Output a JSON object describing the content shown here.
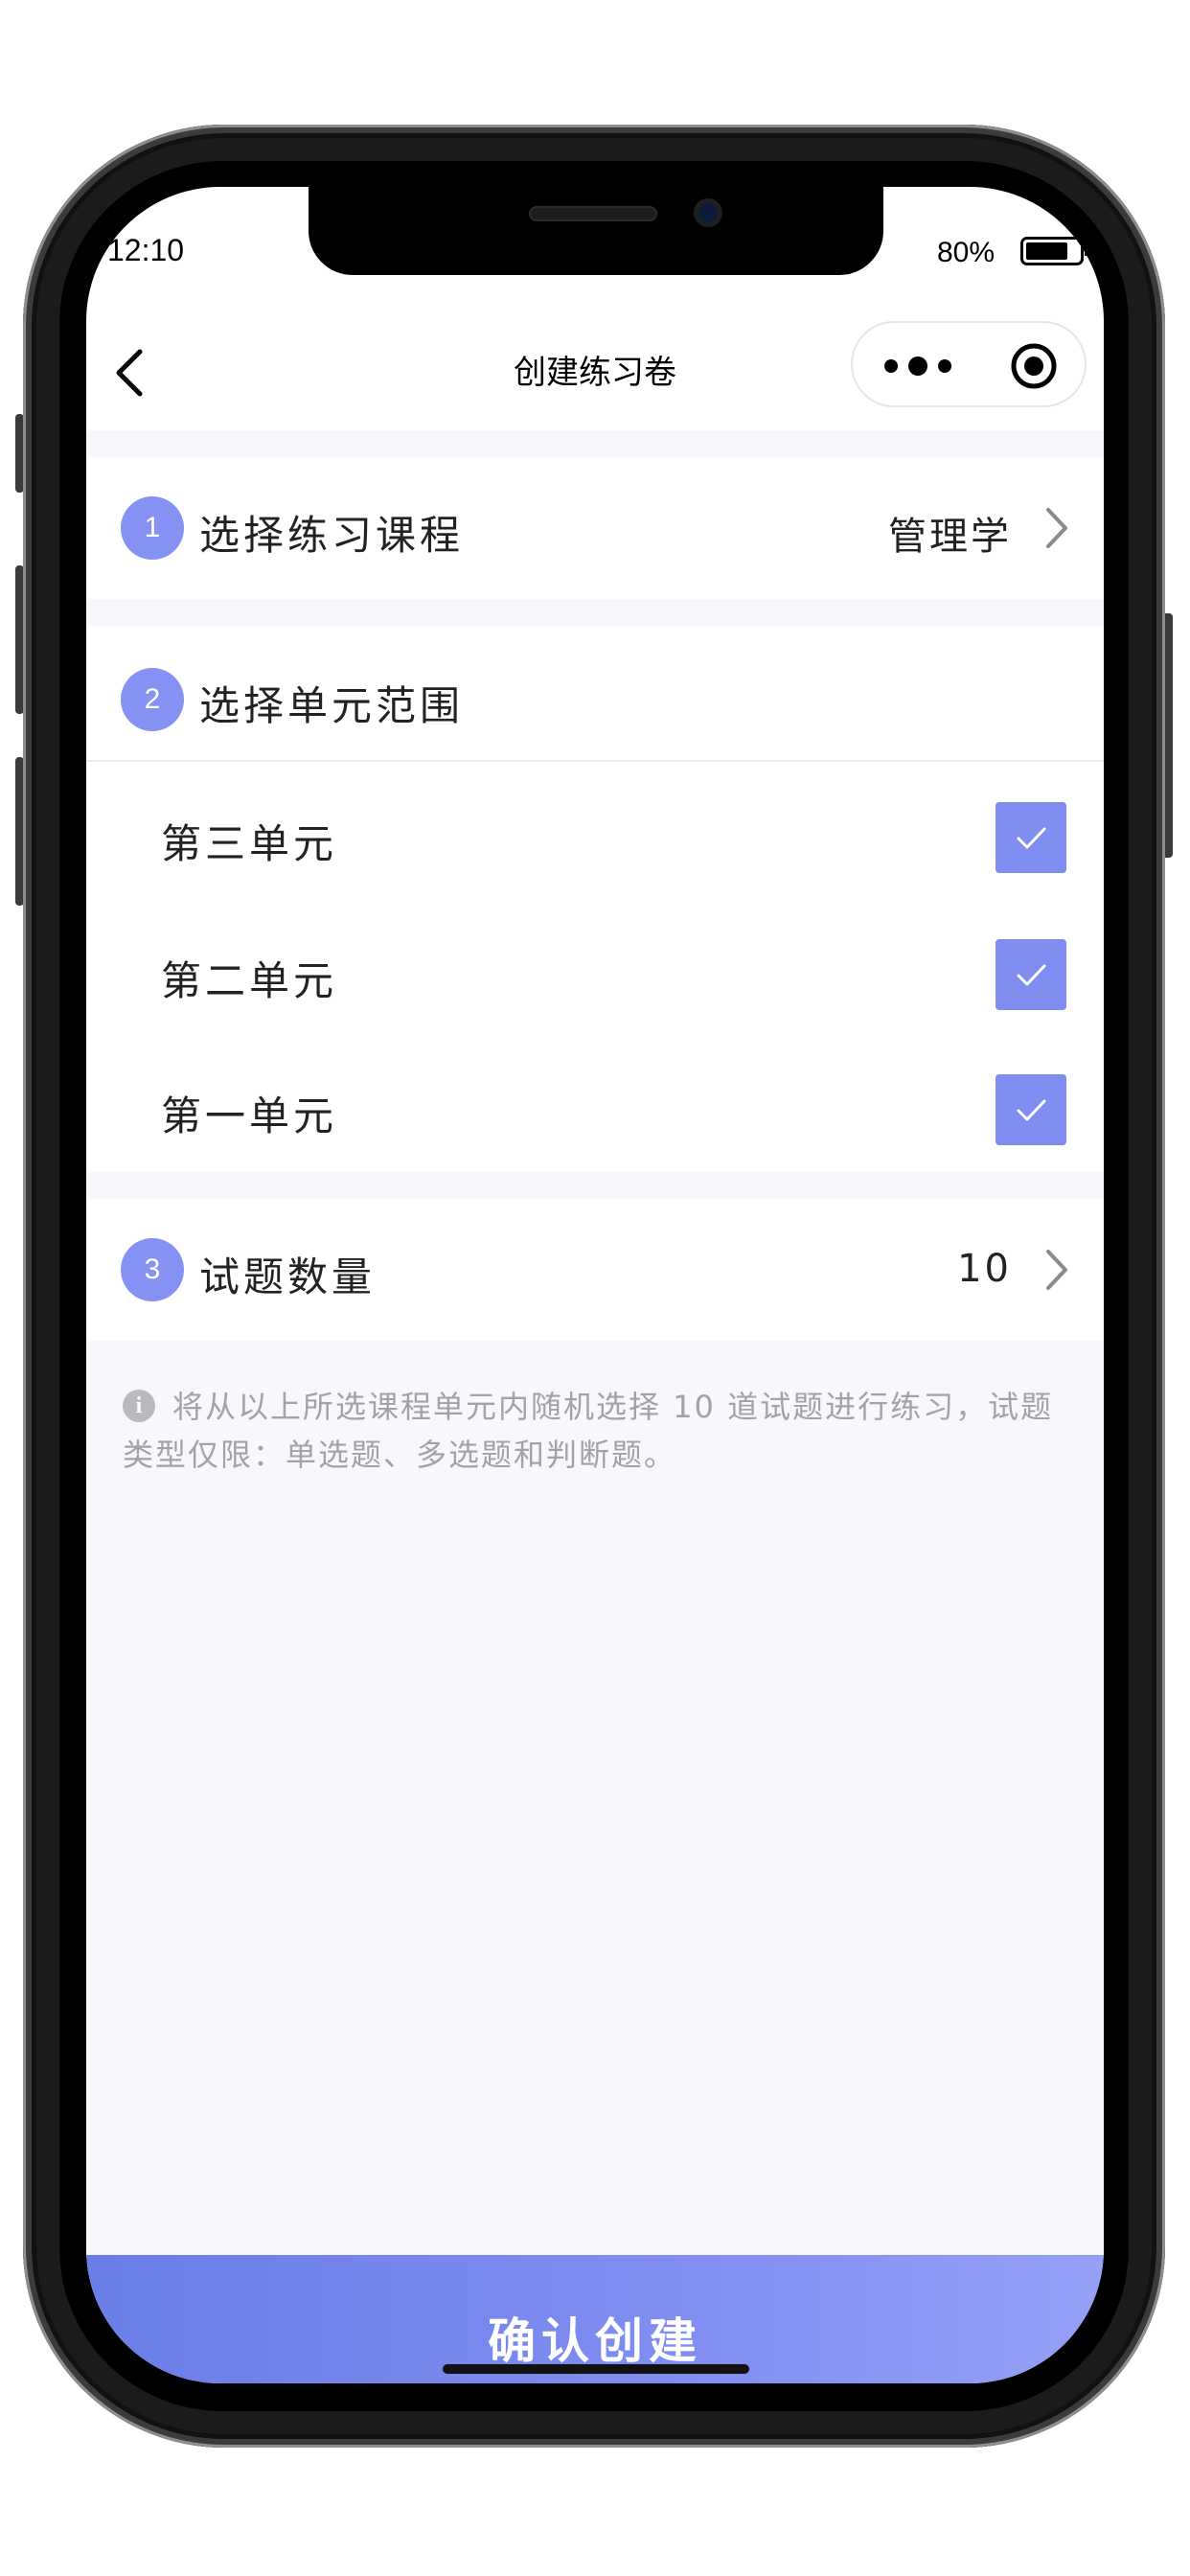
{
  "status_bar": {
    "time": "12:10",
    "battery_text": "80%",
    "battery_level": 0.8
  },
  "nav": {
    "title": "创建练习卷",
    "back_icon": "chevron-left-icon",
    "more_icon": "more-dots-icon",
    "close_icon": "target-circle-icon"
  },
  "steps": [
    {
      "number": "1",
      "label": "选择练习课程",
      "value": "管理学"
    },
    {
      "number": "2",
      "label": "选择单元范围"
    },
    {
      "number": "3",
      "label": "试题数量",
      "value": "10"
    }
  ],
  "units": [
    {
      "label": "第三单元",
      "checked": true
    },
    {
      "label": "第二单元",
      "checked": true
    },
    {
      "label": "第一单元",
      "checked": true
    }
  ],
  "tip": {
    "icon": "info-icon",
    "icon_glyph": "i",
    "text": "将从以上所选课程单元内随机选择 10 道试题进行练习，试题类型仅限：单选题、多选题和判断题。"
  },
  "confirm_button": "确认创建",
  "colors": {
    "accent": "#7f8cf0",
    "page_bg": "#f7f7fc",
    "tip_text": "#a2a2a8"
  }
}
